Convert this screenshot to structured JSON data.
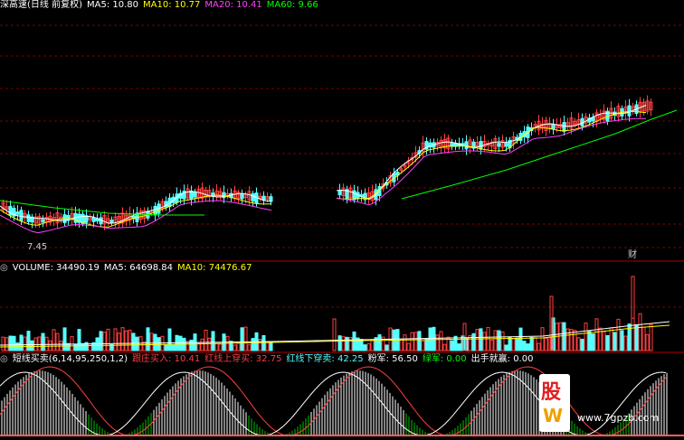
{
  "main_header": {
    "title": "深高速(日线 前复权)",
    "ma5": "MA5: 10.80",
    "ma10": "MA10: 10.77",
    "ma20": "MA20: 10.41",
    "ma60": "MA60: 9.66"
  },
  "low_label": "7.45",
  "event_marker": "财",
  "volume_header": {
    "label": "VOLUME: 34490.19",
    "ma5": "MA5: 64698.84",
    "ma10": "MA10: 74476.67"
  },
  "indicator_header": {
    "name": "短线买卖(6,14,95,250,1,2)",
    "a": "跟庄买入: 10.41",
    "b": "红线上穿买: 32.75",
    "c": "红线下穿卖: 42.25",
    "d": "粉军: 56.50",
    "e": "绿军: 0.00",
    "f": "出手就赢: 0.00"
  },
  "watermark": {
    "logo_top": "股",
    "logo_bottom": "W",
    "url": "www.7gpzb.com"
  },
  "colors": {
    "up": "#ff4040",
    "down": "#54ffff",
    "bg": "#000000",
    "grid": "#7a0000",
    "ma5": "#ffffff",
    "ma10": "#ffff00",
    "ma20": "#ff40ff",
    "ma60": "#00ff00"
  },
  "chart_data": {
    "type": "candlestick",
    "title": "深高速(日线 前复权)",
    "annotations": [
      "7.45",
      "财"
    ],
    "series": [
      {
        "name": "MA5",
        "values": [
          10.8
        ]
      },
      {
        "name": "MA10",
        "values": [
          10.77
        ]
      },
      {
        "name": "MA20",
        "values": [
          10.41
        ]
      },
      {
        "name": "MA60",
        "values": [
          9.66
        ]
      },
      {
        "name": "VOLUME",
        "values": [
          34490.19
        ]
      },
      {
        "name": "VOLUME MA5",
        "values": [
          64698.84
        ]
      },
      {
        "name": "VOLUME MA10",
        "values": [
          74476.67
        ]
      }
    ]
  }
}
